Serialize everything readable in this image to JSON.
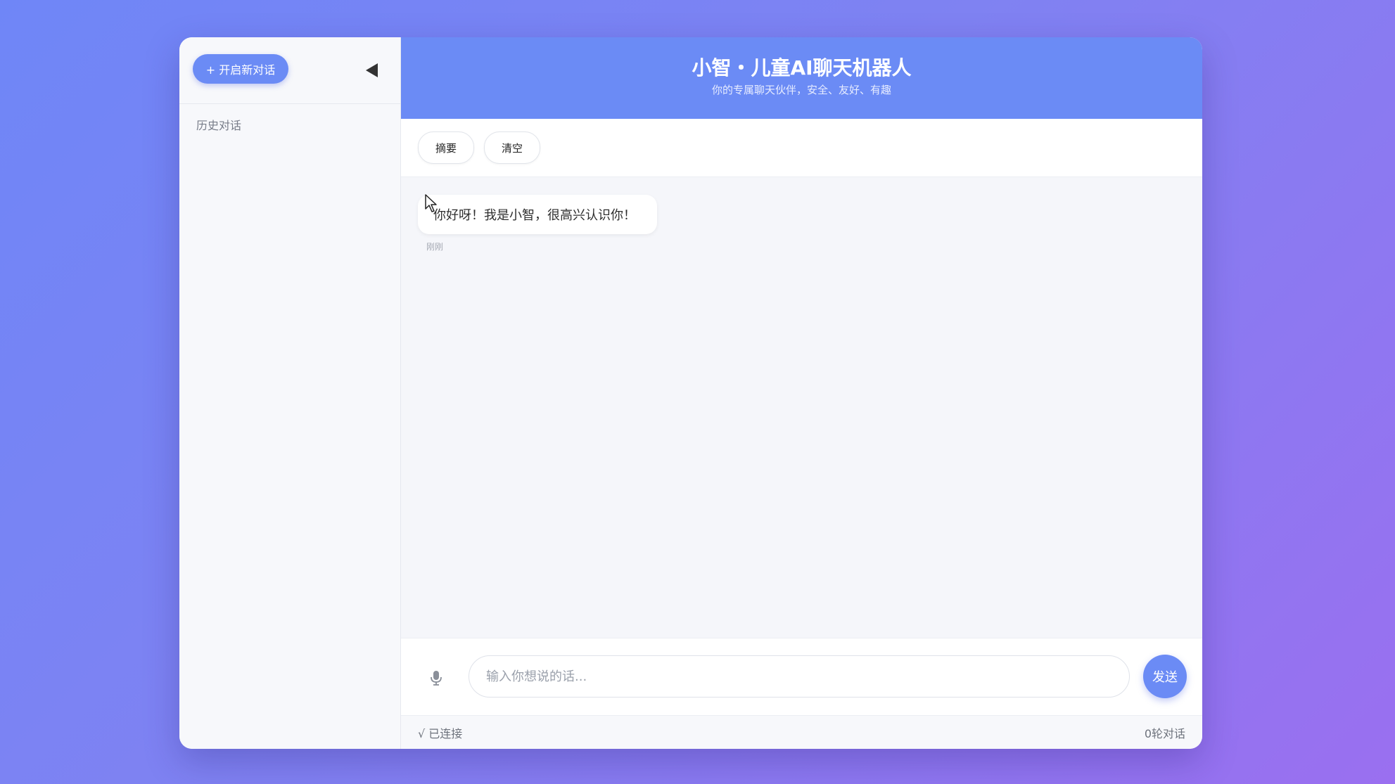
{
  "colors": {
    "accent": "#6b8bf5",
    "background_gradient_start": "#6f86f7",
    "background_gradient_end": "#9a6ff0",
    "chat_background": "#f5f6fa"
  },
  "sidebar": {
    "new_chat_label": "+ 开启新对话",
    "collapse_icon": "triangle-left-icon",
    "history_label": "历史对话"
  },
  "header": {
    "title": "小智・儿童AI聊天机器人",
    "subtitle": "你的专属聊天伙伴，安全、友好、有趣"
  },
  "toolbar": {
    "summary_label": "摘要",
    "clear_label": "清空"
  },
  "messages": [
    {
      "role": "bot",
      "text": "你好呀！我是小智，很高兴认识你！",
      "time": "刚刚"
    }
  ],
  "composer": {
    "mic_icon": "microphone-icon",
    "placeholder": "输入你想说的话...",
    "value": "",
    "send_label": "发送"
  },
  "status": {
    "connection": "√ 已连接",
    "round_count": "0轮对话"
  }
}
